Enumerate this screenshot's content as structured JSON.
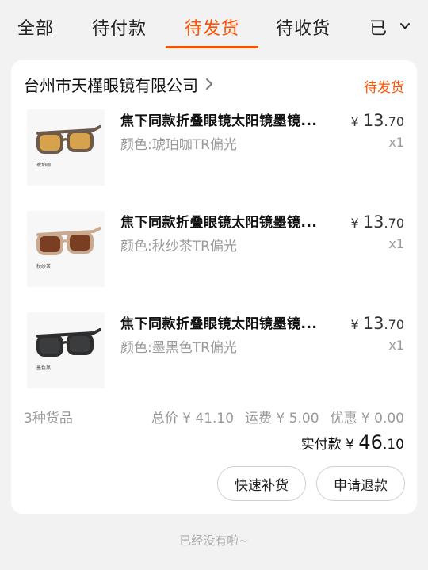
{
  "tabs": [
    {
      "label": "全部"
    },
    {
      "label": "待付款"
    },
    {
      "label": "待发货"
    },
    {
      "label": "待收货"
    },
    {
      "label": "已"
    }
  ],
  "active_tab": "待发货",
  "order": {
    "shop_name": "台州市天槿眼镜有限公司",
    "status": "待发货",
    "items": [
      {
        "title": "焦下同款折叠眼镜太阳镜墨镜...",
        "spec": "颜色:琥珀咖TR偏光",
        "price_symbol": "¥",
        "price_int": "13",
        "price_dec": ".70",
        "qty": "x1",
        "thumb_caption": "琥珀咖",
        "frame_color": "#6e5a4a",
        "lens_color": "#d6a24c"
      },
      {
        "title": "焦下同款折叠眼镜太阳镜墨镜...",
        "spec": "颜色:秋纱茶TR偏光",
        "price_symbol": "¥",
        "price_int": "13",
        "price_dec": ".70",
        "qty": "x1",
        "thumb_caption": "秋纱茶",
        "frame_color": "#c9a98f",
        "lens_color": "#7a3f22"
      },
      {
        "title": "焦下同款折叠眼镜太阳镜墨镜...",
        "spec": "颜色:墨黑色TR偏光",
        "price_symbol": "¥",
        "price_int": "13",
        "price_dec": ".70",
        "qty": "x1",
        "thumb_caption": "墨色黑",
        "frame_color": "#2e2e2e",
        "lens_color": "#3a3c3e"
      }
    ],
    "goods_count": "3种货品",
    "total_label": "总价 ¥ 41.10",
    "shipping_label": "运费 ¥ 5.00",
    "discount_label": "优惠 ¥ 0.00",
    "paid_label": "实付款 ¥ ",
    "paid_int": "46",
    "paid_dec": ".10",
    "buttons": {
      "restock": "快速补货",
      "refund": "申请退款"
    }
  },
  "footer": "已经没有啦~",
  "colors": {
    "accent": "#ff5000",
    "background": "#f2f2f2",
    "card": "#ffffff",
    "muted": "#999999"
  }
}
